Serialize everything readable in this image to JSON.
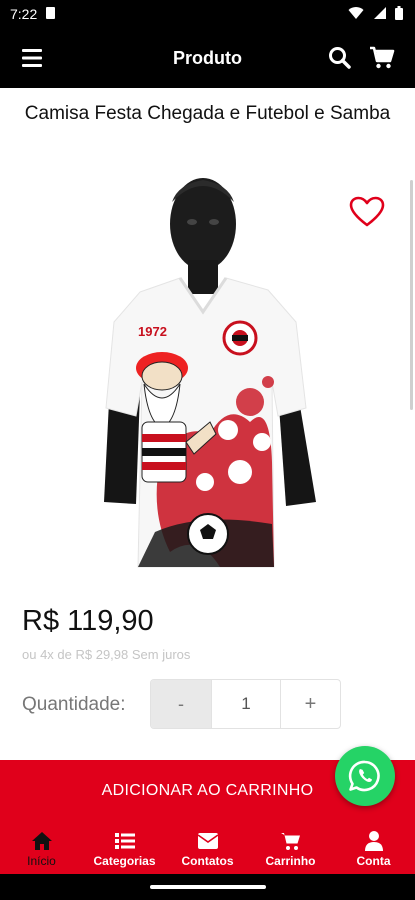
{
  "status_bar": {
    "time": "7:22"
  },
  "app_bar": {
    "title": "Produto"
  },
  "product": {
    "title": "Camisa Festa Chegada e Futebol e Samba",
    "shirt_print_text": "1972",
    "price": "R$ 119,90",
    "installments": "ou 4x de R$ 29,98 Sem juros",
    "quantity_label": "Quantidade:",
    "quantity_value": "1",
    "decrement_label": "-",
    "increment_label": "+",
    "add_to_cart_label": "ADICIONAR AO CARRINHO"
  },
  "bottom_nav": {
    "items": [
      {
        "label": "Início",
        "icon": "home-icon",
        "active": true
      },
      {
        "label": "Categorias",
        "icon": "list-icon",
        "active": false
      },
      {
        "label": "Contatos",
        "icon": "envelope-icon",
        "active": false
      },
      {
        "label": "Carrinho",
        "icon": "cart-icon",
        "active": false
      },
      {
        "label": "Conta",
        "icon": "user-icon",
        "active": false
      }
    ]
  },
  "colors": {
    "accent": "#e0001b",
    "app_bar": "#000000",
    "whatsapp": "#25d366",
    "favorite": "#e0001b"
  }
}
